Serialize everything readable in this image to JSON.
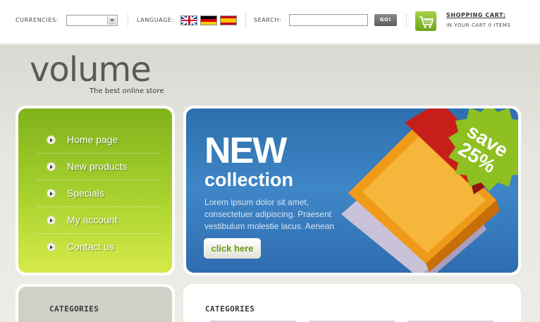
{
  "topbar": {
    "currencies_label": "CURRENCIES:",
    "currency_value": "",
    "language_label": "LANGUAGE:",
    "languages": [
      "English",
      "Deutsch",
      "Español"
    ],
    "search_label": "SEARCH:",
    "search_value": "",
    "go_label": "GO!",
    "cart_title": "SHOPPING CART:",
    "cart_summary": "IN YOUR CART 0 ITEMS"
  },
  "brand": {
    "logo": "volume",
    "tagline": "The best online store"
  },
  "menu": {
    "items": [
      {
        "label": "Home page"
      },
      {
        "label": "New products"
      },
      {
        "label": "Specials"
      },
      {
        "label": "My account"
      },
      {
        "label": "Contact us"
      }
    ]
  },
  "banner": {
    "headline": "NEW",
    "subheadline": "collection",
    "body": "Lorem ipsum dolor sit amet, consectetuer adipiscing. Praesent vestibulum molestie lacus. Aenean",
    "button_label": "click here",
    "badge": "save 25%"
  },
  "sections": {
    "left_categories_title": "CATEGORIES",
    "right_categories_title": "CATEGORIES"
  },
  "colors": {
    "accent_green": "#8fc021",
    "banner_blue": "#3f86c6",
    "page_bg": "#e4e4de"
  }
}
